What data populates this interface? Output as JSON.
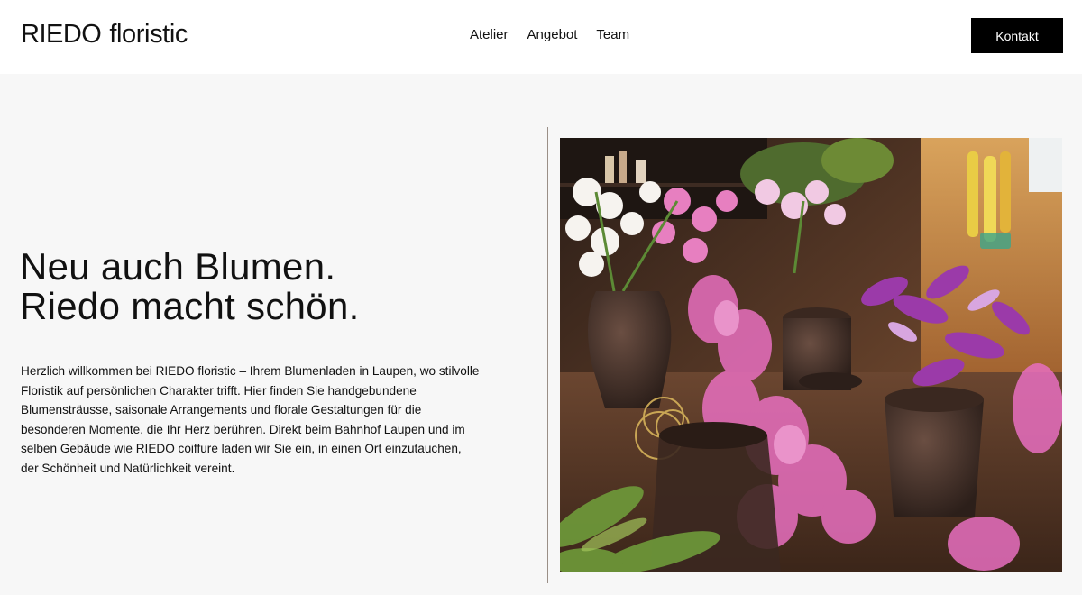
{
  "header": {
    "logo": {
      "word1": "RIEDO",
      "word2": "floristic"
    },
    "nav": [
      {
        "label": "Atelier"
      },
      {
        "label": "Angebot"
      },
      {
        "label": "Team"
      }
    ],
    "cta_label": "Kontakt"
  },
  "hero": {
    "headline_line1": "Neu auch Blumen.",
    "headline_line2": "Riedo macht schön.",
    "intro": "Herzlich willkommen bei RIEDO floristic – Ihrem Blumenladen in Laupen, wo stilvolle Floristik auf persönlichen Charakter trifft. Hier finden Sie handgebundene Blumensträusse, saisonale Arrangements und florale Gestaltungen für die besonderen Momente, die Ihr Herz berühren. Direkt beim Bahnhof Laupen und im selben Gebäude wie RIEDO coiffure laden wir Sie ein, in einen Ort einzutauchen, der Schönheit und Natürlichkeit vereint."
  },
  "colors": {
    "page_background": "#f7f7f7",
    "header_background": "#ffffff",
    "button_background": "#000000",
    "button_text": "#ffffff",
    "text": "#111111",
    "divider": "#9a8f87"
  }
}
